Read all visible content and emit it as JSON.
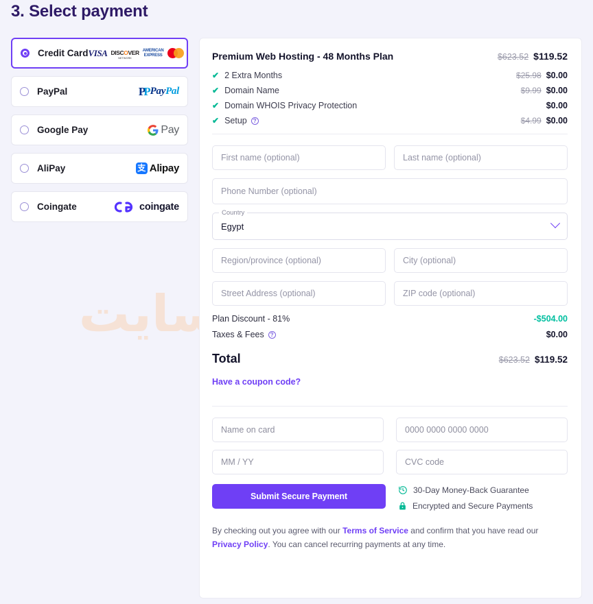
{
  "page": {
    "title": "3. Select payment",
    "accent_color": "#6f3ff5",
    "title_color": "#2e1a66",
    "background_color": "#f3f3fb",
    "discount_color": "#00bfa0",
    "watermark_text": "أفضل سايت"
  },
  "payment_methods": [
    {
      "label": "Credit Card",
      "selected": true,
      "logo": "credit-cards"
    },
    {
      "label": "PayPal",
      "selected": false,
      "logo": "paypal"
    },
    {
      "label": "Google Pay",
      "selected": false,
      "logo": "google-pay"
    },
    {
      "label": "AliPay",
      "selected": false,
      "logo": "alipay"
    },
    {
      "label": "Coingate",
      "selected": false,
      "logo": "coingate"
    }
  ],
  "card_brands": [
    "VISA",
    "DISCOVER",
    "AMERICAN EXPRESS",
    "Mastercard"
  ],
  "brand_text": {
    "visa": "VISA",
    "discover_main": "DISC",
    "discover_rest": "VER",
    "discover_sub": "NETWORK",
    "amex_line1": "AMERICAN",
    "amex_line2": "EXPRESS",
    "paypal_p1": "Pay",
    "paypal_p2": "Pal",
    "gpay_pay": "Pay",
    "alipay_glyph": "支",
    "alipay_text": "Alipay",
    "coingate_text": "coingate"
  },
  "order": {
    "plan_name": "Premium Web Hosting - 48 Months Plan",
    "plan_old_price": "$623.52",
    "plan_new_price": "$119.52",
    "features": [
      {
        "label": "2 Extra Months",
        "old": "$25.98",
        "new": "$0.00",
        "help": false
      },
      {
        "label": "Domain Name",
        "old": "$9.99",
        "new": "$0.00",
        "help": false
      },
      {
        "label": "Domain WHOIS Privacy Protection",
        "old": "",
        "new": "$0.00",
        "help": false
      },
      {
        "label": "Setup",
        "old": "$4.99",
        "new": "$0.00",
        "help": true
      }
    ],
    "summary": [
      {
        "label": "Plan Discount - 81%",
        "value": "-$504.00",
        "discount": true,
        "help": false
      },
      {
        "label": "Taxes & Fees",
        "value": "$0.00",
        "discount": false,
        "help": true
      }
    ],
    "total_label": "Total",
    "total_old": "$623.52",
    "total_new": "$119.52",
    "coupon_link": "Have a coupon code?"
  },
  "billing_form": {
    "first_name_placeholder": "First name (optional)",
    "last_name_placeholder": "Last name (optional)",
    "phone_placeholder": "Phone Number (optional)",
    "country_label": "Country",
    "country_value": "Egypt",
    "region_placeholder": "Region/province (optional)",
    "city_placeholder": "City (optional)",
    "street_placeholder": "Street Address (optional)",
    "zip_placeholder": "ZIP code (optional)"
  },
  "card_form": {
    "name_placeholder": "Name on card",
    "number_placeholder": "0000 0000 0000 0000",
    "expiry_placeholder": "MM / YY",
    "cvc_placeholder": "CVC code"
  },
  "submit": {
    "label": "Submit Secure Payment"
  },
  "badges": [
    {
      "label": "30-Day Money-Back Guarantee",
      "icon": "clock-refresh-icon"
    },
    {
      "label": "Encrypted and Secure Payments",
      "icon": "lock-icon"
    }
  ],
  "legal": {
    "part1": "By checking out you agree with our ",
    "link1": "Terms of Service",
    "part2": " and confirm that you have read our ",
    "link2": "Privacy Policy",
    "part3": ". You can cancel recurring payments at any time."
  },
  "help_icon_glyph": "?"
}
